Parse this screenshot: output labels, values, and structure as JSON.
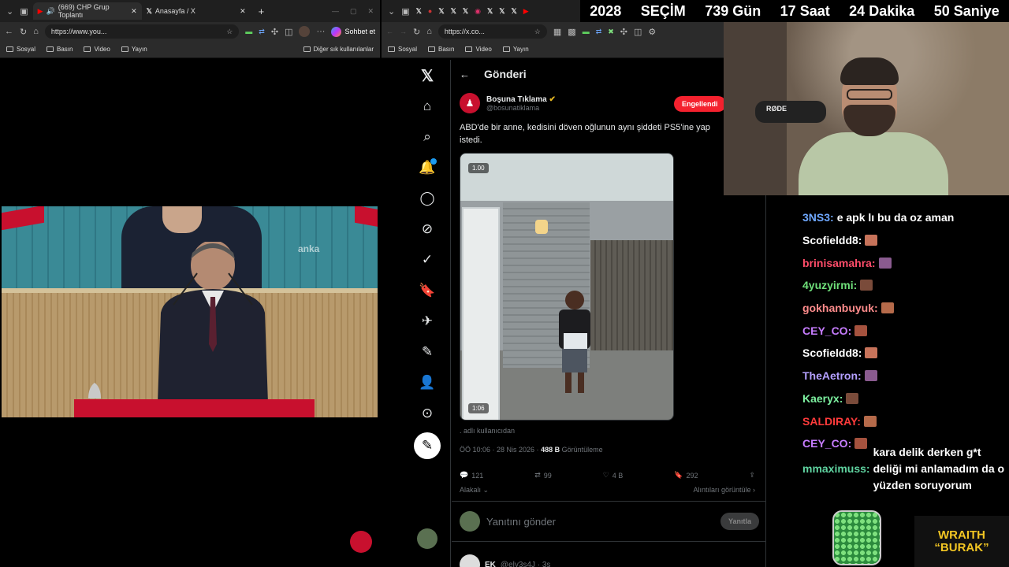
{
  "left_browser": {
    "tabs": [
      {
        "label": "(669) CHP Grup Toplantı"
      },
      {
        "label": "Anasayfa / X"
      }
    ],
    "url": "https://www.you...",
    "chat_button": "Sohbet et",
    "bookmarks": [
      "Sosyal",
      "Basın",
      "Video",
      "Yayın"
    ],
    "other_bookmarks": "Diğer sık kullanılanlar",
    "video_watermark": "anka"
  },
  "right_browser": {
    "url": "https://x.co...",
    "bookmarks": [
      "Sosyal",
      "Basın",
      "Video",
      "Yayın"
    ]
  },
  "countdown": {
    "year": "2028",
    "label": "SEÇİM",
    "days": "739 Gün",
    "hours": "17 Saat",
    "minutes": "24 Dakika",
    "seconds": "50 Saniye"
  },
  "x_post": {
    "header_title": "Gönderi",
    "author_name": "Boşuna Tıklama",
    "author_handle": "@bosunatiklama",
    "blocked_label": "Engellendi",
    "text": "ABD'de bir anne, kedisini döven oğlunun aynı şiddeti PS5'ine yap istedi.",
    "media_speed": "1.00",
    "media_duration": "1:06",
    "source": "adlı kullanıcıdan",
    "time": "ÖÖ 10:06 · 28 Nis 2026 ·",
    "views": "488 B",
    "views_label": "Görüntüleme",
    "replies": "121",
    "reposts": "99",
    "likes": "4 B",
    "bookmarks": "292",
    "relevant": "Alakalı",
    "quotes": "Alıntıları görüntüle",
    "reply_placeholder": "Yanıtını gönder",
    "reply_button": "Yanıtla",
    "next_reply_author": "EK",
    "next_reply_meta": "@ely3s4J · 3s"
  },
  "webcam": {
    "mic_brand": "RØDE"
  },
  "chat": [
    {
      "user": "3NS3:",
      "text": "e apk lı bu da oz aman",
      "color": "#6fa8ff"
    },
    {
      "user": "Scofieldd8:",
      "text": "",
      "color": "#ffffff"
    },
    {
      "user": "brinisamahra:",
      "text": "",
      "color": "#ff4d6a"
    },
    {
      "user": "4yuzyirmi:",
      "text": "",
      "color": "#6fe07a"
    },
    {
      "user": "gokhanbuyuk:",
      "text": "",
      "color": "#ff8c8c"
    },
    {
      "user": "CEY_CO:",
      "text": "",
      "color": "#c77dff"
    },
    {
      "user": "Scofieldd8:",
      "text": "",
      "color": "#ffffff"
    },
    {
      "user": "TheAetron:",
      "text": "",
      "color": "#b4a0ff"
    },
    {
      "user": "Kaeryx:",
      "text": "",
      "color": "#7df0a0"
    },
    {
      "user": "SALDIRAY:",
      "text": "",
      "color": "#ff3b3b"
    },
    {
      "user": "CEY_CO:",
      "text": "",
      "color": "#c77dff"
    },
    {
      "user": "mmaximuss:",
      "text": "kara delik derken g*t deliği mi anlamadım da o yüzden soruyorum",
      "color": "#5fd3a0"
    }
  ],
  "brand": {
    "line1": "WRAITH",
    "line2": "“BURAK”"
  }
}
